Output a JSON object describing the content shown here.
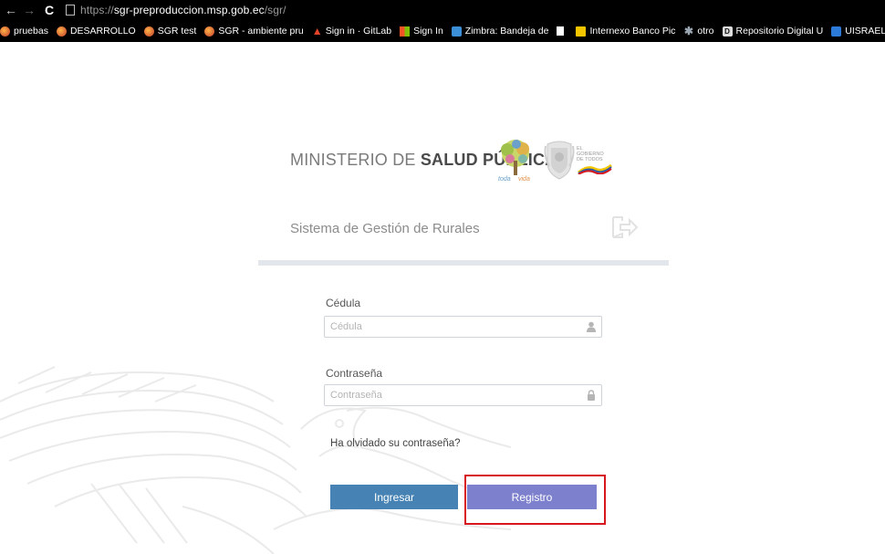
{
  "browser": {
    "url_scheme": "https://",
    "url_host": "sgr-preproduccion.msp.gob.ec",
    "url_path": "/sgr/",
    "bookmarks": [
      {
        "label": "pruebas",
        "icon": "mono-icon"
      },
      {
        "label": "DESARROLLO",
        "icon": "mono-icon"
      },
      {
        "label": "SGR test",
        "icon": "mono-icon"
      },
      {
        "label": "SGR - ambiente pru",
        "icon": "mono-icon"
      },
      {
        "label": "Sign in · GitLab",
        "icon": "gitlab-icon"
      },
      {
        "label": "Sign In",
        "icon": "microsoft-icon"
      },
      {
        "label": "Zimbra: Bandeja de",
        "icon": "zimbra-icon"
      },
      {
        "label": "",
        "icon": "document-icon"
      },
      {
        "label": "Internexo Banco Pic",
        "icon": "yellow-icon"
      },
      {
        "label": "otro",
        "icon": "star-icon"
      },
      {
        "label": "Repositorio Digital U",
        "icon": "repo-icon"
      },
      {
        "label": "UISRAEL: Pres. y S",
        "icon": "uisrael-icon"
      }
    ]
  },
  "header": {
    "ministry_prefix": "MINISTERIO DE ",
    "ministry_bold": "SALUD PÚBLICA",
    "gob_line1": "EL",
    "gob_line2": "GOBIERNO",
    "gob_line3": "DE TODOS",
    "system_title": "Sistema de Gestión de Rurales"
  },
  "form": {
    "cedula_label": "Cédula",
    "cedula_placeholder": "Cédula",
    "password_label": "Contraseña",
    "password_placeholder": "Contraseña",
    "forgot_link": "Ha olvidado su contraseña?",
    "login_button": "Ingresar",
    "register_button": "Registro"
  },
  "colors": {
    "login_button": "#4683b4",
    "register_button": "#7d80cc",
    "highlight_border": "#d6171e"
  }
}
